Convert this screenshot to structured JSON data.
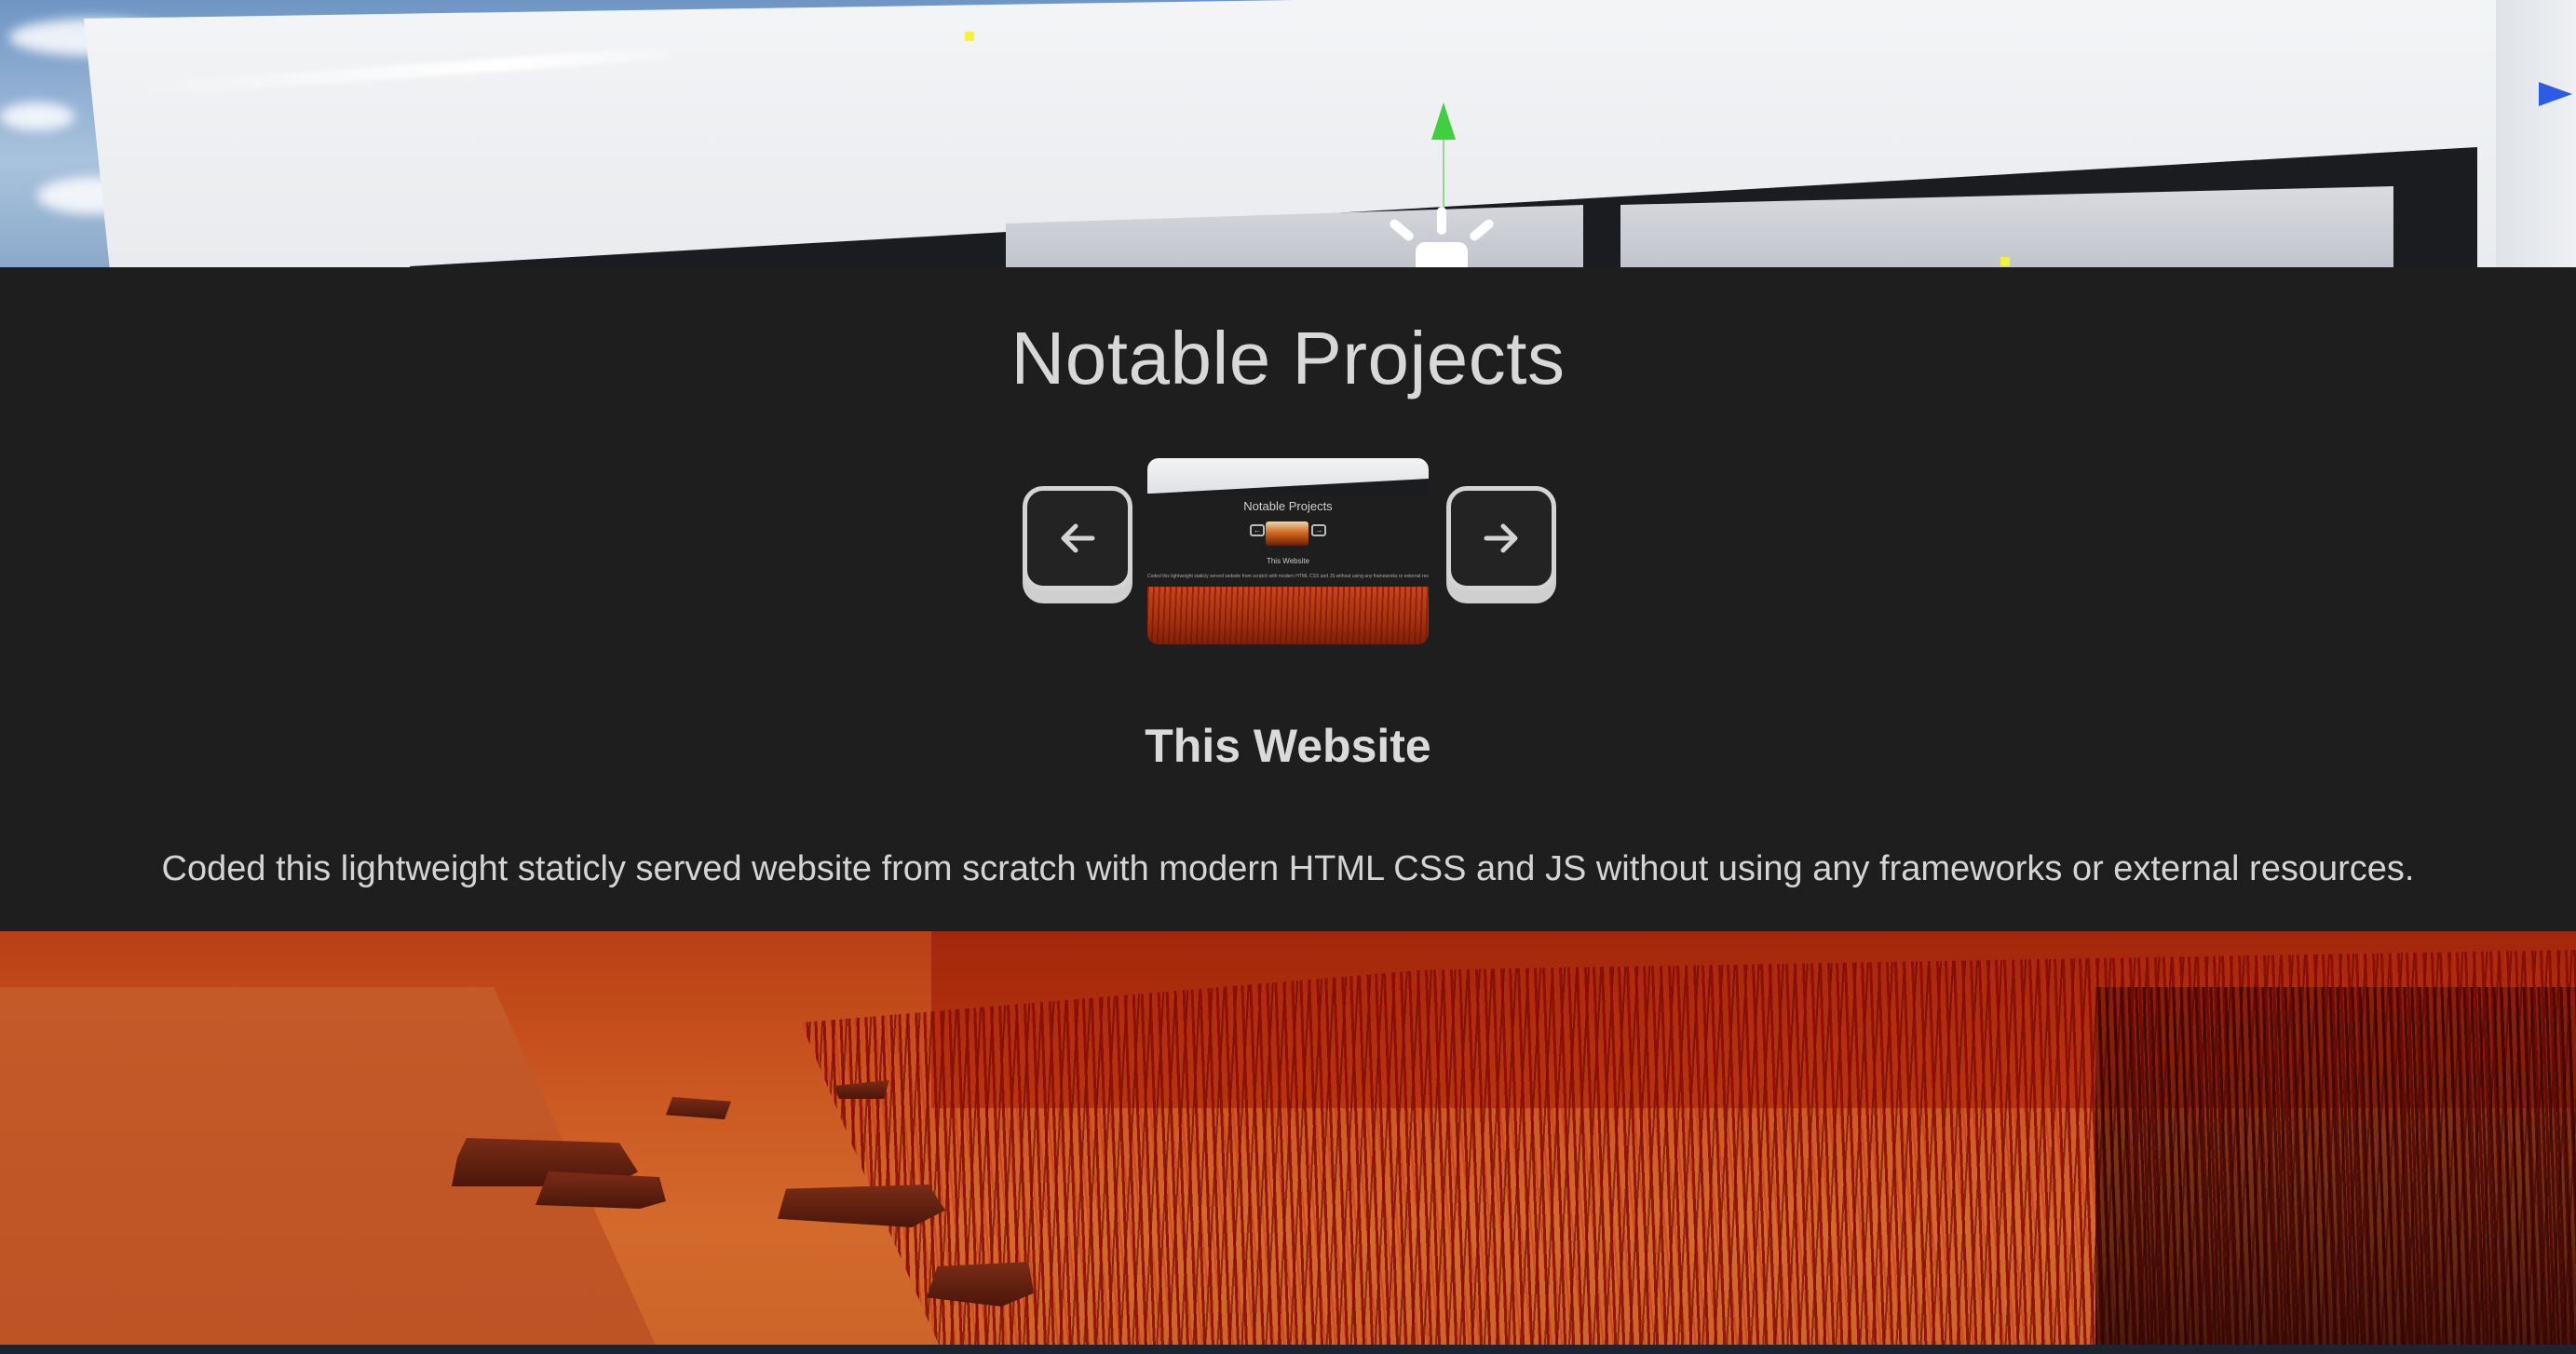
{
  "section": {
    "title": "Notable Projects"
  },
  "carousel": {
    "prev_icon": "arrow-left-icon",
    "next_icon": "arrow-right-icon",
    "thumbnail": {
      "title": "Notable Projects",
      "subtitle": "This Website",
      "description": "Coded this lightweight staticly served website from scratch with modern HTML CSS and JS without using any frameworks or external resources."
    }
  },
  "project": {
    "name": "This Website",
    "description": "Coded this lightweight staticly served website from scratch with modern HTML CSS and JS without using any frameworks or external resources."
  },
  "colors": {
    "panel_background": "#1e1e1e",
    "text": "#d8d8d8",
    "button_border": "#d4d4d4"
  }
}
